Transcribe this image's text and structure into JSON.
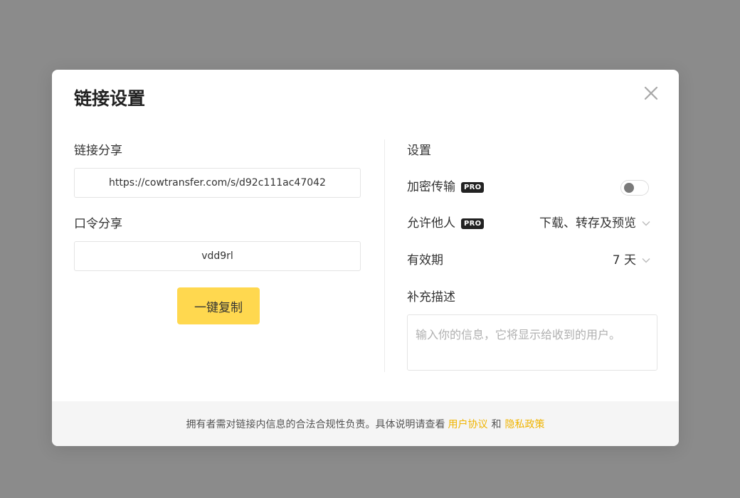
{
  "dialog": {
    "title": "链接设置"
  },
  "left": {
    "link_label": "链接分享",
    "link_value": "https://cowtransfer.com/s/d92c111ac47042",
    "code_label": "口令分享",
    "code_value": "vdd9rl",
    "copy_button": "一键复制"
  },
  "right": {
    "heading": "设置",
    "encrypt_label": "加密传输",
    "allow_label": "允许他人",
    "allow_value": "下载、转存及预览",
    "expiry_label": "有效期",
    "expiry_value": "7 天",
    "description_label": "补充描述",
    "description_placeholder": "输入你的信息，它将显示给收到的用户。",
    "pro_badge": "PRO",
    "encrypt_enabled": false
  },
  "footer": {
    "text": "拥有者需对链接内信息的合法合规性负责。具体说明请查看",
    "user_agreement": "用户协议",
    "and": "和",
    "privacy_policy": "隐私政策"
  },
  "colors": {
    "overlay": "#8b8b8b",
    "accent_button": "#ffd84f",
    "link": "#f0b400",
    "badge": "#222222"
  },
  "icons": {
    "close": "close-icon",
    "chevron": "chevron-down-icon"
  }
}
